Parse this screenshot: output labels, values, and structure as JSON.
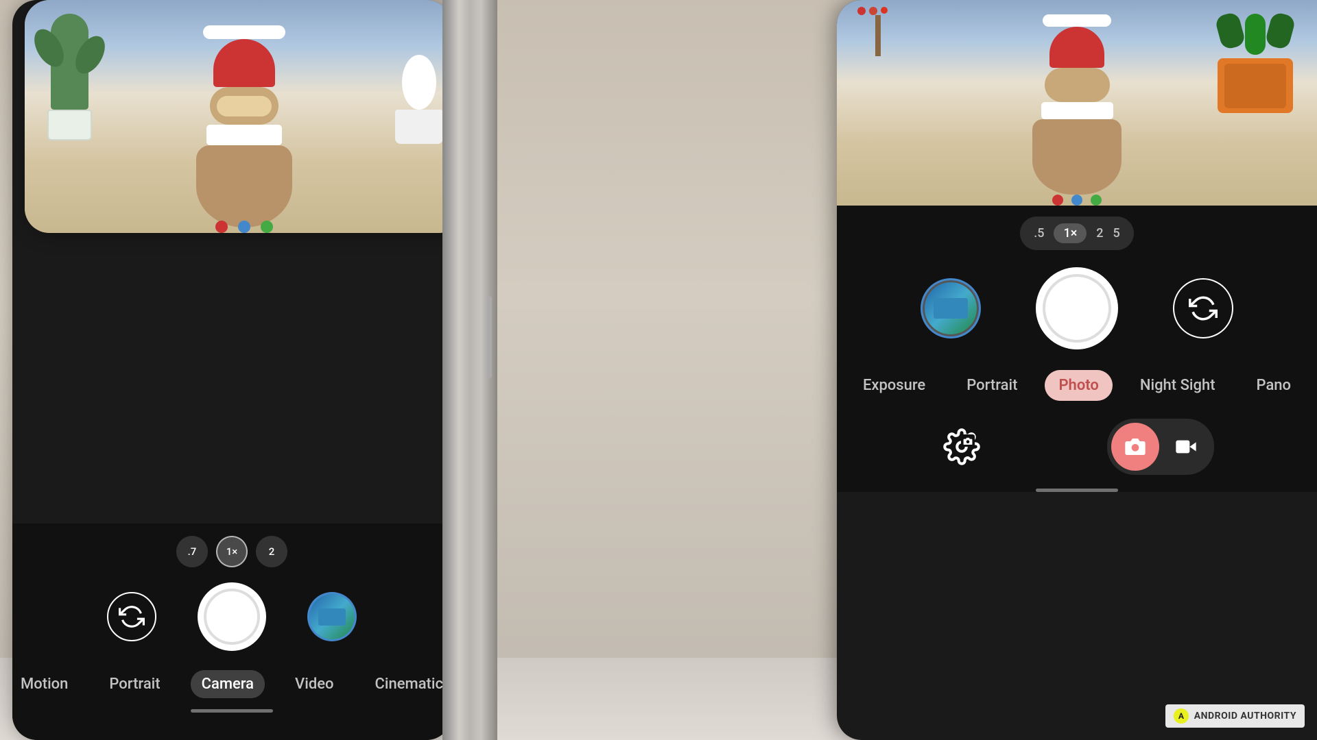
{
  "scene": {
    "background_color": "#b8b0a8"
  },
  "phone_left": {
    "zoom_options": [
      {
        "label": ".7",
        "active": false
      },
      {
        "label": "1×",
        "active": true
      },
      {
        "label": "2",
        "active": false
      }
    ],
    "modes": [
      {
        "label": "Motion",
        "active": false
      },
      {
        "label": "Portrait",
        "active": false
      },
      {
        "label": "Camera",
        "active": true
      },
      {
        "label": "Video",
        "active": false
      },
      {
        "label": "Cinematic",
        "active": false
      }
    ],
    "flip_icon": "↺",
    "gallery_thumb_alt": "gallery thumbnail"
  },
  "phone_right": {
    "zoom_options": [
      {
        "label": ".5",
        "active": false
      },
      {
        "label": "1×",
        "active": true
      },
      {
        "label": "2",
        "active": false
      },
      {
        "label": "5",
        "active": false
      }
    ],
    "modes": [
      {
        "label": "Exposure",
        "active": false
      },
      {
        "label": "Portrait",
        "active": false
      },
      {
        "label": "Photo",
        "active": true
      },
      {
        "label": "Night Sight",
        "active": false
      },
      {
        "label": "Pano",
        "active": false
      }
    ],
    "flip_icon": "↺",
    "settings_icon": "⚙",
    "photo_icon": "📷",
    "video_icon": "▶"
  },
  "watermark": {
    "logo": "A",
    "text": "ANDROID AUTHORITY"
  }
}
